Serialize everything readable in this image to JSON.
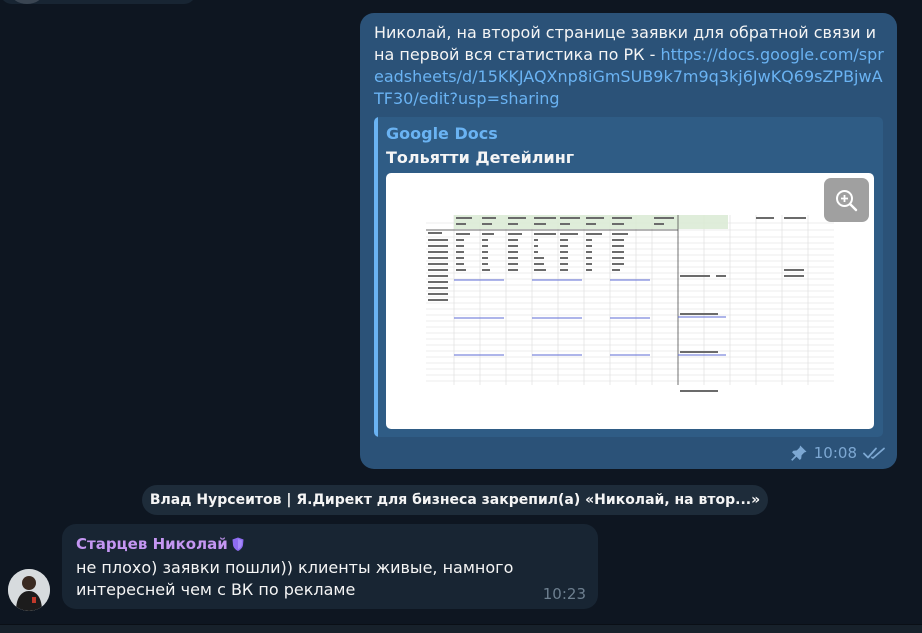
{
  "outgoing": {
    "text": "Николай, на второй странице заявки для обратной связи и на первой вся статистика по РК - ",
    "link": "https://docs.google.com/spreadsheets/d/15KKJAQXnp8iGmSUB9k7m9q3kj6JwKQ69sZPBjwATF30/edit?usp=sharing",
    "preview": {
      "site": "Google Docs",
      "title": "Тольятти Детейлинг"
    },
    "time": "10:08",
    "pinned": true,
    "read": true
  },
  "service": {
    "text": "Влад Нурсеитов | Я.Директ для бизнеса закрепил(а) «Николай, на втор...»"
  },
  "incoming": {
    "sender": "Старцев Николай",
    "text": "не плохо) заявки пошли)) клиенты живые, намного интересней чем с ВК по рекламе",
    "time": "10:23"
  },
  "colors": {
    "chat_bg": "#0e1621",
    "outgoing_bubble": "#2b5278",
    "incoming_bubble": "#182533",
    "link": "#6ab3f3",
    "sender_name": "#c496f2"
  }
}
